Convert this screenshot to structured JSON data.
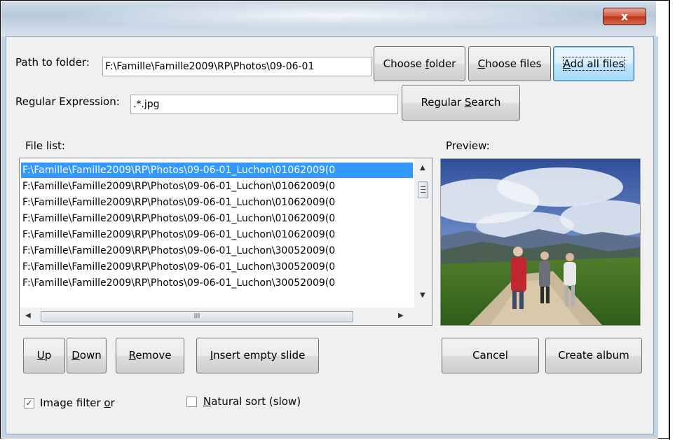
{
  "dialog": {
    "close_glyph": "x"
  },
  "path": {
    "label": "Path to folder:",
    "value": "F:\\Famille\\Famille2009\\RP\\Photos\\09-06-01"
  },
  "buttons": {
    "choose_folder": {
      "pre": "Choose ",
      "key": "f",
      "post": "older"
    },
    "choose_files": {
      "pre": "",
      "key": "C",
      "post": "hoose files"
    },
    "add_all_files": {
      "pre": "",
      "key": "A",
      "post": "dd all files"
    },
    "regular_search": {
      "pre": "Regular ",
      "key": "S",
      "post": "earch"
    },
    "up": {
      "pre": "",
      "key": "U",
      "post": "p"
    },
    "down": {
      "pre": "",
      "key": "D",
      "post": "own"
    },
    "remove": {
      "pre": "",
      "key": "R",
      "post": "emove"
    },
    "insert_empty_slide": {
      "pre": "",
      "key": "I",
      "post": "nsert empty slide"
    },
    "cancel": "Cancel",
    "create_album": "Create album"
  },
  "regex": {
    "label": "Regular Expression:",
    "value": ".*.jpg"
  },
  "file_list": {
    "label": "File list:",
    "items": [
      "F:\\Famille\\Famille2009\\RP\\Photos\\09-06-01_Luchon\\01062009(0",
      "F:\\Famille\\Famille2009\\RP\\Photos\\09-06-01_Luchon\\01062009(0",
      "F:\\Famille\\Famille2009\\RP\\Photos\\09-06-01_Luchon\\01062009(0",
      "F:\\Famille\\Famille2009\\RP\\Photos\\09-06-01_Luchon\\01062009(0",
      "F:\\Famille\\Famille2009\\RP\\Photos\\09-06-01_Luchon\\01062009(0",
      "F:\\Famille\\Famille2009\\RP\\Photos\\09-06-01_Luchon\\30052009(0",
      "F:\\Famille\\Famille2009\\RP\\Photos\\09-06-01_Luchon\\30052009(0",
      "F:\\Famille\\Famille2009\\RP\\Photos\\09-06-01_Luchon\\30052009(0"
    ],
    "selected_index": 0,
    "hscroll_grip": "III"
  },
  "preview": {
    "label": "Preview:"
  },
  "checkboxes": {
    "image_filter": {
      "pre": "Image filter ",
      "key": "o",
      "post": "r",
      "checked": true
    },
    "natural_sort": {
      "pre": "",
      "key": "N",
      "post": "atural sort (slow)",
      "checked": false
    }
  },
  "colors": {
    "selection": "#3399ff",
    "default_button": "#3c7fb1"
  }
}
